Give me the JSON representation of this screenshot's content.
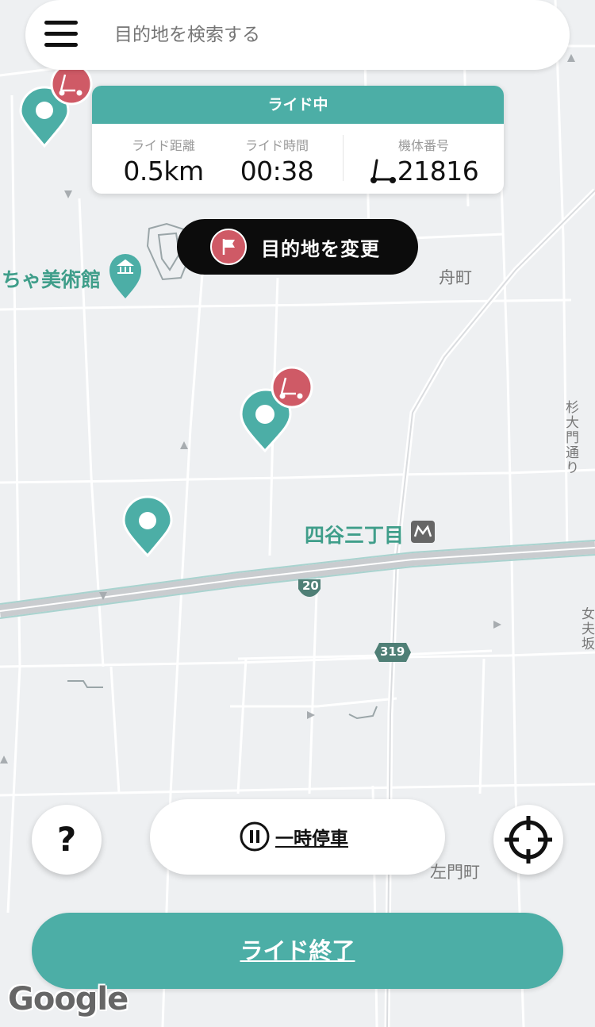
{
  "search": {
    "placeholder": "目的地を検索する"
  },
  "ride_status": {
    "title": "ライド中",
    "distance_label": "ライド距離",
    "distance_value": "0.5km",
    "time_label": "ライド時間",
    "time_value": "00:38",
    "device_label": "機体番号",
    "device_value": "21816"
  },
  "change_destination": {
    "label": "目的地を変更"
  },
  "map_labels": {
    "museum": "ちゃ美術館",
    "funamachi": "舟町",
    "station": "四谷三丁目",
    "route_20": "20",
    "route_319": "319",
    "samonmachi": "左門町",
    "sugidaimon": "杉大門通り",
    "onnazaka": "女夫坂"
  },
  "help": {
    "label": "?"
  },
  "pause": {
    "label": "一時停車"
  },
  "end_ride": {
    "label": "ライド終了"
  },
  "attribution": "Google",
  "colors": {
    "accent": "#4caea6",
    "scooter": "#cf5a66",
    "dark": "#0c0c0c"
  }
}
